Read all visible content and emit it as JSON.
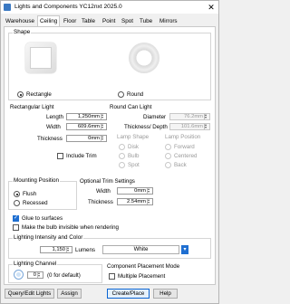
{
  "window": {
    "title": "Lights and Components  YC12nxt 2025.0",
    "close": "✕"
  },
  "tabs": [
    "Warehouse",
    "Ceiling",
    "Floor",
    "Table",
    "Point",
    "Spot",
    "Tube",
    "Mirrors"
  ],
  "active_tab": "Ceiling",
  "shape": {
    "title": "Shape",
    "rect_label": "Rectangle",
    "round_label": "Round",
    "selected": "Rectangle"
  },
  "rect_light": {
    "title": "Rectangular Light",
    "length_label": "Length",
    "length_value": "1,250mm",
    "width_label": "Width",
    "width_value": "609.6mm",
    "thickness_label": "Thickness",
    "thickness_value": "0mm",
    "include_trim": "Include Trim"
  },
  "round_light": {
    "title": "Round Can Light",
    "diameter_label": "Diameter",
    "diameter_value": "76.2mm",
    "thickness_depth_label": "Thickness/ Depth",
    "thickness_depth_value": "101.6mm",
    "lamp_shape_label": "Lamp Shape",
    "lamp_shape_options": [
      "Disk",
      "Bulb",
      "Spot"
    ],
    "lamp_position_label": "Lamp Position",
    "lamp_position_options": [
      "Forward",
      "Centered",
      "Back"
    ]
  },
  "mounting": {
    "title": "Mounting Position",
    "flush": "Flush",
    "recessed": "Recessed",
    "selected": "Flush"
  },
  "trim": {
    "title": "Optional Trim Settings",
    "width_label": "Width",
    "width_value": "0mm",
    "thickness_label": "Thickness",
    "thickness_value": "2.54mm"
  },
  "options": {
    "glue": "Glue to surfaces",
    "invisible": "Make the bulb invisible when rendering"
  },
  "intensity": {
    "title": "Lighting Intensity and Color",
    "value": "1,150",
    "unit": "Lumens",
    "color": "White"
  },
  "channel": {
    "title": "Lighting Channel",
    "value": "0",
    "hint": "(0 for default)"
  },
  "placement": {
    "title": "Component Placement Mode",
    "multiple": "Multiple Placement"
  },
  "footer": {
    "query": "Query/Edit Lights",
    "assign": "Assign",
    "create": "Create/Place",
    "help": "Help"
  },
  "icons": {
    "rect_preview": "square-light-icon",
    "round_preview": "round-light-icon",
    "color_dropdown": "chevron-down-icon",
    "channel": "lighting-channel-icon"
  },
  "colors": {
    "accent": "#1f6fd1",
    "selected_border": "#0a64d2"
  }
}
